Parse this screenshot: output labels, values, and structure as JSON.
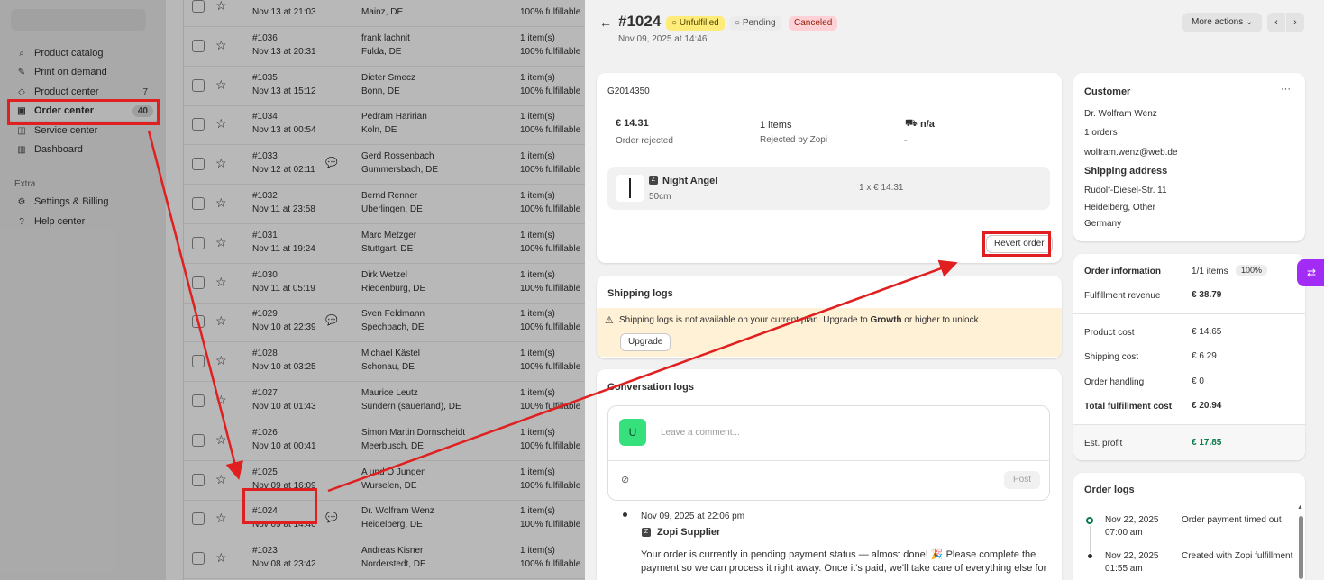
{
  "sidebar": {
    "items": [
      {
        "label": "Product catalog",
        "icon": "search-icon",
        "glyph": "⌕",
        "count": ""
      },
      {
        "label": "Print on demand",
        "icon": "brush-icon",
        "glyph": "✎",
        "count": ""
      },
      {
        "label": "Product center",
        "icon": "tag-icon",
        "glyph": "◇",
        "count": "7"
      },
      {
        "label": "Order center",
        "icon": "inbox-icon",
        "glyph": "▣",
        "count": "40"
      },
      {
        "label": "Service center",
        "icon": "service-icon",
        "glyph": "◫",
        "count": ""
      },
      {
        "label": "Dashboard",
        "icon": "chart-icon",
        "glyph": "▥",
        "count": ""
      }
    ],
    "section_label": "Extra",
    "extra_items": [
      {
        "label": "Settings & Billing",
        "icon": "gear-icon",
        "glyph": "⚙"
      },
      {
        "label": "Help center",
        "icon": "help-icon",
        "glyph": "?"
      }
    ]
  },
  "orders": [
    {
      "num": "",
      "date": "Nov 13 at 21:03",
      "name": "",
      "loc": "Mainz, DE",
      "items": "",
      "fulfill": "100% fulfillable",
      "chat": false
    },
    {
      "num": "#1036",
      "date": "Nov 13 at 20:31",
      "name": "frank lachnit",
      "loc": "Fulda, DE",
      "items": "1 item(s)",
      "fulfill": "100% fulfillable",
      "chat": false
    },
    {
      "num": "#1035",
      "date": "Nov 13 at 15:12",
      "name": "Dieter Smecz",
      "loc": "Bonn, DE",
      "items": "1 item(s)",
      "fulfill": "100% fulfillable",
      "chat": false
    },
    {
      "num": "#1034",
      "date": "Nov 13 at 00:54",
      "name": "Pedram Haririan",
      "loc": "Koln, DE",
      "items": "1 item(s)",
      "fulfill": "100% fulfillable",
      "chat": false
    },
    {
      "num": "#1033",
      "date": "Nov 12 at 02:11",
      "name": "Gerd Rossenbach",
      "loc": "Gummersbach, DE",
      "items": "1 item(s)",
      "fulfill": "100% fulfillable",
      "chat": true
    },
    {
      "num": "#1032",
      "date": "Nov 11 at 23:58",
      "name": "Bernd Renner",
      "loc": "Uberlingen, DE",
      "items": "1 item(s)",
      "fulfill": "100% fulfillable",
      "chat": false
    },
    {
      "num": "#1031",
      "date": "Nov 11 at 19:24",
      "name": "Marc Metzger",
      "loc": "Stuttgart, DE",
      "items": "1 item(s)",
      "fulfill": "100% fulfillable",
      "chat": false
    },
    {
      "num": "#1030",
      "date": "Nov 11 at 05:19",
      "name": "Dirk Wetzel",
      "loc": "Riedenburg, DE",
      "items": "1 item(s)",
      "fulfill": "100% fulfillable",
      "chat": false
    },
    {
      "num": "#1029",
      "date": "Nov 10 at 22:39",
      "name": "Sven Feldmann",
      "loc": "Spechbach, DE",
      "items": "1 item(s)",
      "fulfill": "100% fulfillable",
      "chat": true
    },
    {
      "num": "#1028",
      "date": "Nov 10 at 03:25",
      "name": "Michael Kästel",
      "loc": "Schonau, DE",
      "items": "1 item(s)",
      "fulfill": "100% fulfillable",
      "chat": false
    },
    {
      "num": "#1027",
      "date": "Nov 10 at 01:43",
      "name": "Maurice Leutz",
      "loc": "Sundern (sauerland), DE",
      "items": "1 item(s)",
      "fulfill": "100% fulfillable",
      "chat": false
    },
    {
      "num": "#1026",
      "date": "Nov 10 at 00:41",
      "name": "Simon Martin Dornscheidt",
      "loc": "Meerbusch, DE",
      "items": "1 item(s)",
      "fulfill": "100% fulfillable",
      "chat": false
    },
    {
      "num": "#1025",
      "date": "Nov 09 at 16:09",
      "name": "A und O Jungen",
      "loc": "Wurselen, DE",
      "items": "1 item(s)",
      "fulfill": "100% fulfillable",
      "chat": false
    },
    {
      "num": "#1024",
      "date": "Nov 09 at 14:46",
      "name": "Dr. Wolfram Wenz",
      "loc": "Heidelberg, DE",
      "items": "1 item(s)",
      "fulfill": "100% fulfillable",
      "chat": true
    },
    {
      "num": "#1023",
      "date": "Nov 08 at 23:42",
      "name": "Andreas Kisner",
      "loc": "Norderstedt, DE",
      "items": "1 item(s)",
      "fulfill": "100% fulfillable",
      "chat": false
    }
  ],
  "detail": {
    "back": "←",
    "title": "#1024",
    "badges": {
      "unfulfilled": "○ Unfulfilled",
      "pending": "○ Pending",
      "canceled": "Canceled"
    },
    "date": "Nov 09, 2025 at 14:46",
    "more_actions": "More actions ⌄",
    "prev": "‹",
    "next": "›",
    "fulfillment": {
      "id": "G2014350",
      "amount": "€ 14.31",
      "status": "Order rejected",
      "items": "1 items",
      "rejected_by": "Rejected by Zopi",
      "shipping": "n/a",
      "shipping_sub": "-",
      "product_name": "Night Angel",
      "product_variant": "50cm",
      "product_qty_price": "1 x € 14.31",
      "revert_label": "Revert order"
    },
    "shipping_logs": {
      "title": "Shipping logs",
      "warning_pre": "Shipping logs is not available on your current plan. Upgrade to ",
      "warning_plan": "Growth",
      "warning_post": " or higher to unlock.",
      "upgrade_label": "Upgrade"
    },
    "conversation": {
      "title": "Conversation logs",
      "avatar": "U",
      "placeholder": "Leave a comment...",
      "post_label": "Post",
      "entry_time": "Nov 09, 2025 at 22:06 pm",
      "entry_author": "Zopi Supplier",
      "entry_text_1": "Your order is currently in pending payment status — almost done! 🎉 Please complete the",
      "entry_text_2": "payment so we can process it right away. Once it's paid, we'll take care of everything else for"
    },
    "customer": {
      "title": "Customer",
      "menu": "···",
      "name": "Dr. Wolfram Wenz",
      "orders": "1 orders",
      "email": "wolfram.wenz@web.de",
      "shipping_title": "Shipping address",
      "addr1": "Rudolf-Diesel-Str. 11",
      "addr2": "Heidelberg, Other",
      "addr3": "Germany"
    },
    "order_info": {
      "title": "Order information",
      "items": "1/1 items",
      "percent": "100%",
      "revenue_label": "Fulfillment revenue",
      "revenue": "€ 38.79",
      "product_cost_label": "Product cost",
      "product_cost": "€ 14.65",
      "shipping_cost_label": "Shipping cost",
      "shipping_cost": "€ 6.29",
      "handling_label": "Order handling",
      "handling": "€ 0",
      "total_label": "Total fulfillment cost",
      "total": "€ 20.94",
      "profit_label": "Est. profit",
      "profit": "€ 17.85"
    },
    "order_logs": {
      "title": "Order logs",
      "entries": [
        {
          "date": "Nov 22, 2025",
          "time": "07:00 am",
          "text": "Order payment timed out"
        },
        {
          "date": "Nov 22, 2025",
          "time": "01:55 am",
          "text": "Created with Zopi fulfillment"
        }
      ]
    }
  },
  "colors": {
    "annotation": "#e02020",
    "profit": "#0c7a4a",
    "accent": "#a22cf5"
  }
}
